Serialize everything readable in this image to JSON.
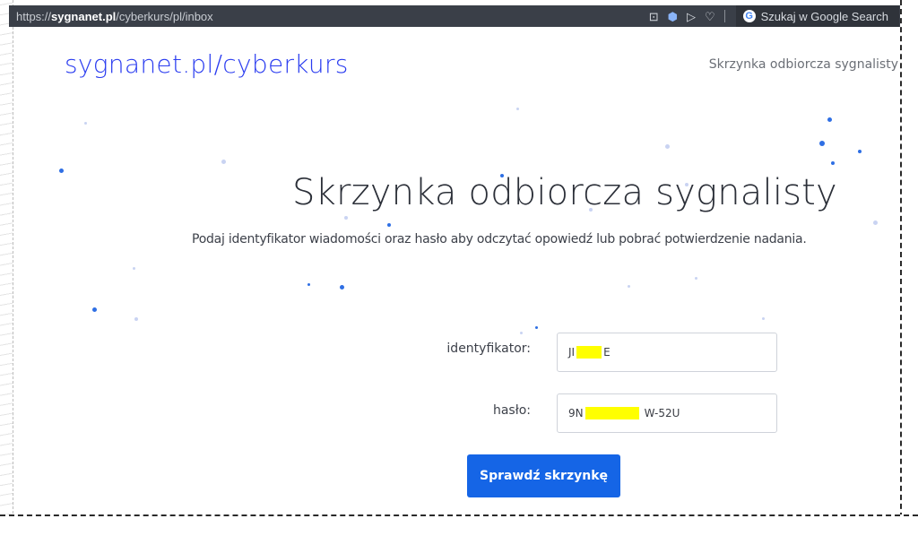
{
  "browser": {
    "url_prefix": "https://",
    "url_host": "sygnanet.pl",
    "url_path": "/cyberkurs/pl/inbox",
    "search_label": "Szukaj w Google Search"
  },
  "header": {
    "logo": "sygnanet.pl/cyberkurs",
    "nav_link": "Skrzynka odbiorcza sygnalisty"
  },
  "main": {
    "title": "Skrzynka odbiorcza sygnalisty",
    "subtitle": "Podaj identyfikator wiadomości oraz hasło aby odczytać opowiedź lub pobrać potwierdzenie nadania."
  },
  "form": {
    "identifier_label": "identyfikator:",
    "identifier_value_start": "JI",
    "identifier_value_end": "E",
    "password_label": "hasło:",
    "password_value_start": "9N",
    "password_value_end": "W-52U",
    "submit_label": "Sprawdź skrzynkę"
  },
  "colors": {
    "accent": "#1565e6",
    "logo": "#2a3cf0",
    "redaction": "#ffff00"
  }
}
